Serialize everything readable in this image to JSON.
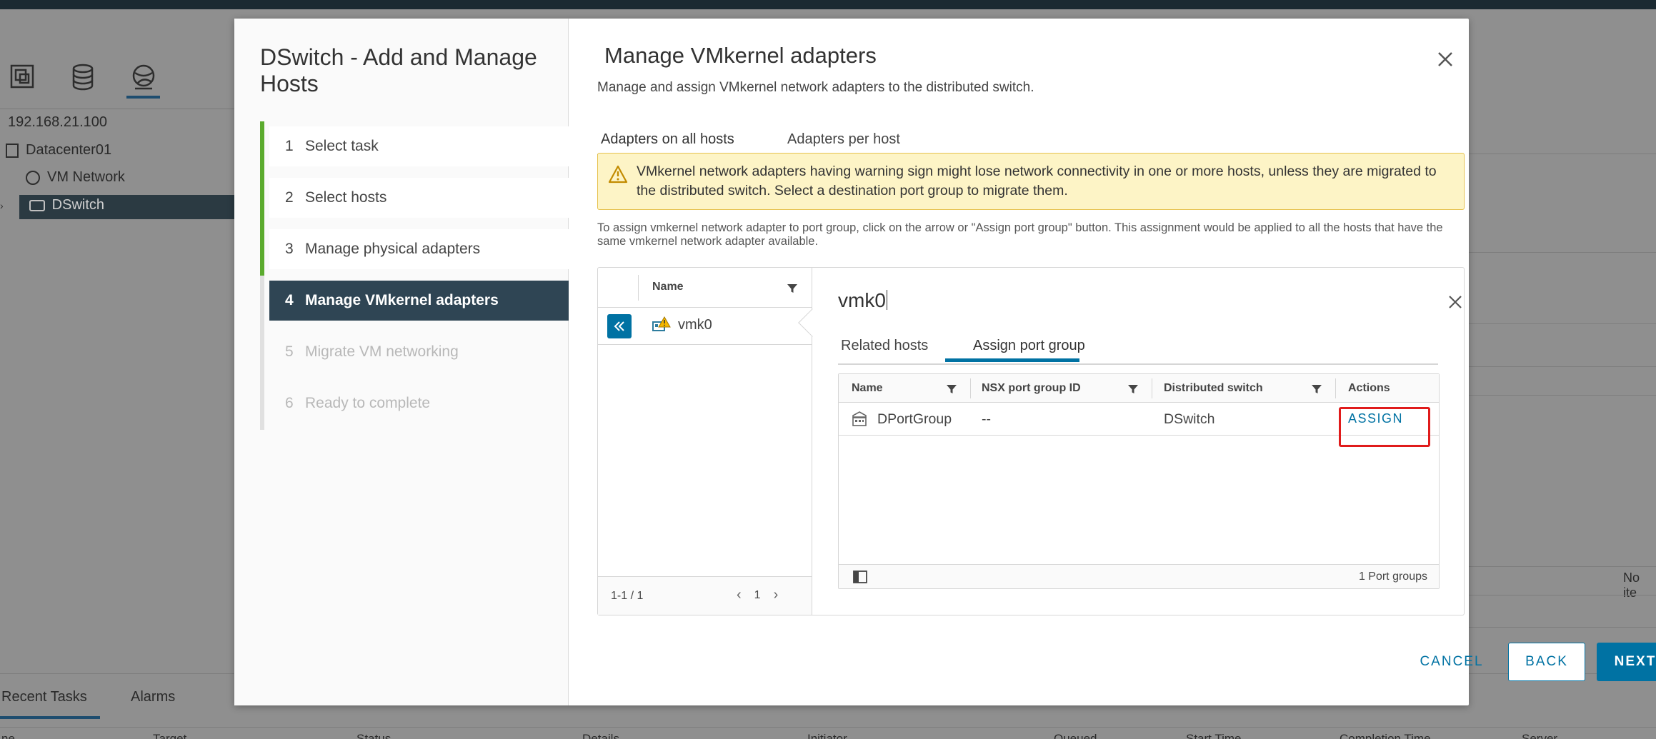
{
  "background": {
    "tree": {
      "host_ip": "192.168.21.100",
      "datacenter": "Datacenter01",
      "network": "VM Network",
      "dswitch": "DSwitch"
    },
    "no_items_text": "No ite",
    "bottom_tabs": [
      "Recent Tasks",
      "Alarms"
    ],
    "bottom_columns": [
      "ne",
      "Target",
      "Status",
      "Details",
      "Initiator",
      "Queued",
      "Start Time",
      "Completion Time",
      "Server"
    ]
  },
  "wizard": {
    "title": "DSwitch - Add and Manage Hosts",
    "steps": [
      {
        "num": "1",
        "label": "Select task"
      },
      {
        "num": "2",
        "label": "Select hosts"
      },
      {
        "num": "3",
        "label": "Manage physical adapters"
      },
      {
        "num": "4",
        "label": "Manage VMkernel adapters"
      },
      {
        "num": "5",
        "label": "Migrate VM networking"
      },
      {
        "num": "6",
        "label": "Ready to complete"
      }
    ],
    "current_step": 4
  },
  "page": {
    "title": "Manage VMkernel adapters",
    "description": "Manage and assign VMkernel network adapters to the distributed switch.",
    "tabs": [
      "Adapters on all hosts",
      "Adapters per host"
    ],
    "warning": "VMkernel network adapters having warning sign might lose network connectivity in one or more hosts, unless they are migrated to the distributed switch. Select a destination port group to migrate them.",
    "info": "To assign vmkernel network adapter to port group, click on the arrow or \"Assign port group\" button. This assignment would be applied to all the hosts that have the same vmkernel network adapter available."
  },
  "adapter_list": {
    "header_name": "Name",
    "items": [
      {
        "name": "vmk0",
        "status": "warning"
      }
    ],
    "count": "1-1 / 1",
    "page": "1"
  },
  "detail": {
    "title": "vmk0",
    "tabs": [
      "Related hosts",
      "Assign port group"
    ],
    "columns": [
      "Name",
      "NSX port group ID",
      "Distributed switch",
      "Actions"
    ],
    "rows": [
      {
        "name": "DPortGroup",
        "nsx_id": "--",
        "switch": "DSwitch",
        "action": "ASSIGN"
      }
    ],
    "footer_count": "1 Port groups"
  },
  "buttons": {
    "cancel": "CANCEL",
    "back": "BACK",
    "next": "NEXT"
  },
  "colors": {
    "accent": "#0072a3",
    "active_step_bg": "#2f4554",
    "done_step_bar": "#5bab2e",
    "warning_bg": "#fdf4c6",
    "highlight": "#e01b1b"
  }
}
